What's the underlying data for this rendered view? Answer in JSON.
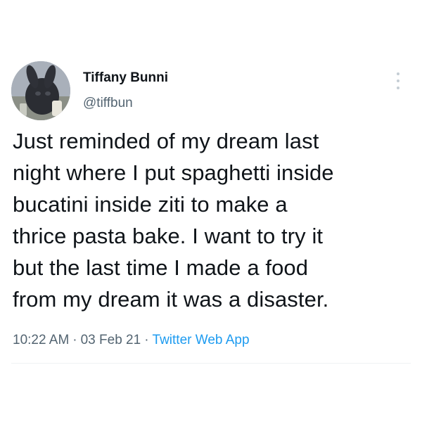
{
  "author": {
    "display_name": "Tiffany Bunni",
    "handle": "@tiffbun",
    "avatar_icon": "profile-avatar-photo"
  },
  "menu": {
    "icon": "more-vertical-icon"
  },
  "tweet": {
    "text_lines": [
      "Just reminded of my dream last",
      "night where I put spaghetti inside",
      "bucatini inside ziti to make a",
      "thrice pasta bake. I want to try it",
      "but the last time I made a food",
      "from my dream it was a disaster."
    ]
  },
  "meta": {
    "time": "10:22 AM",
    "date": "03 Feb 21",
    "separator": "·",
    "source": "Twitter Web App"
  },
  "colors": {
    "text": "#0f1419",
    "secondary": "#536471",
    "link": "#1d9bf0",
    "divider": "#eff3f4"
  }
}
